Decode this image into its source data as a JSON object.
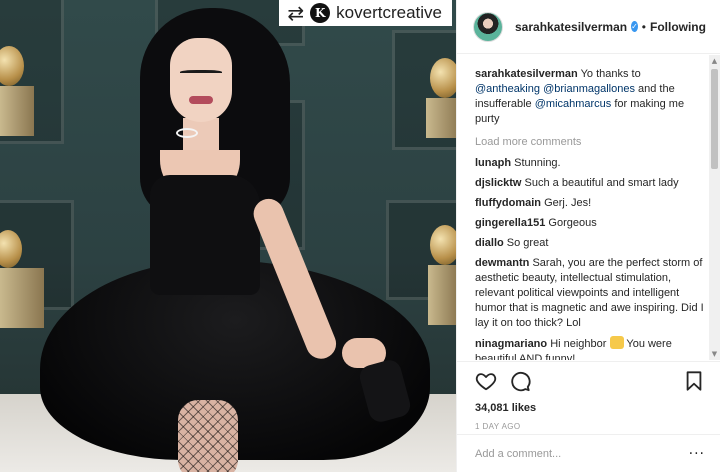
{
  "photo": {
    "repost_icon": "repost-arrows-icon",
    "repost_logo_letter": "K",
    "repost_account": "kovertcreative"
  },
  "header": {
    "username": "sarahkatesilverman",
    "separator": "•",
    "follow_label": "Following"
  },
  "caption": {
    "username": "sarahkatesilverman",
    "parts": [
      "Yo thanks to ",
      "@antheaking",
      " ",
      "@brianmagallones",
      " and the insufferable ",
      "@micahmarcus",
      " for making me purty"
    ]
  },
  "load_more": "Load more comments",
  "comments": [
    {
      "user": "lunaph",
      "text": "Stunning."
    },
    {
      "user": "djslicktw",
      "text": "Such a beautiful and smart lady"
    },
    {
      "user": "fluffydomain",
      "text": "Gerj. Jes!"
    },
    {
      "user": "gingerella151",
      "text": "Gorgeous"
    },
    {
      "user": "diallo",
      "text": "So great"
    },
    {
      "user": "dewmantn",
      "text": "Sarah, you are the perfect storm of aesthetic beauty, intellectual stimulation, relevant political viewpoints and intelligent humor that is magnetic and awe inspiring. Did I lay it on too thick? Lol"
    },
    {
      "user": "ninagmariano",
      "text_before": "Hi neighbor ",
      "text_after": " You were beautiful AND funny!"
    }
  ],
  "actions": {
    "like_icon": "heart-icon",
    "comment_icon": "comment-bubble-icon",
    "save_icon": "bookmark-icon"
  },
  "likes": "34,081 likes",
  "time": "1 DAY AGO",
  "add_comment": {
    "placeholder": "Add a comment...",
    "more": "···"
  },
  "colors": {
    "link": "#003569",
    "verified": "#3897f0",
    "muted": "#999999"
  }
}
